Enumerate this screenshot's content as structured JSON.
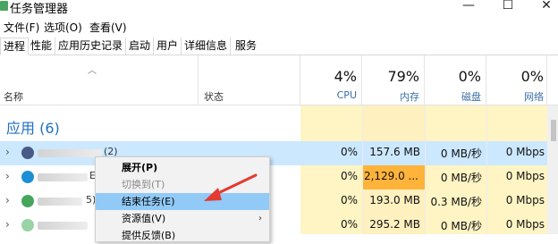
{
  "window": {
    "title": "任务管理器",
    "min": "—",
    "max": "☐",
    "close": "✕"
  },
  "menu": [
    "文件(F)",
    "选项(O)",
    "查看(V)"
  ],
  "tabs": [
    "进程",
    "性能",
    "应用历史记录",
    "启动",
    "用户",
    "详细信息",
    "服务"
  ],
  "columns": {
    "name": "名称",
    "status": "状态",
    "cpu": {
      "pct": "4%",
      "label": "CPU"
    },
    "mem": {
      "pct": "79%",
      "label": "内存"
    },
    "disk": {
      "pct": "0%",
      "label": "磁盘"
    },
    "net": {
      "pct": "0%",
      "label": "网络"
    }
  },
  "group_label": "应用 (6)",
  "rows": [
    {
      "suffix": "(2)",
      "cpu": "0%",
      "mem": "157.6 MB",
      "disk": "0 MB/秒",
      "net": "0 Mbps",
      "icon_color": "#4a5a86"
    },
    {
      "suffix": "E",
      "cpu": "0%",
      "mem": "2,129.0 ...",
      "disk": "0 MB/秒",
      "net": "0 Mbps",
      "icon_color": "#1e8fd6"
    },
    {
      "suffix": "5)",
      "cpu": "0%",
      "mem": "193.0 MB",
      "disk": "0.3 MB/秒",
      "net": "0 Mbps",
      "icon_color": "#46a65e"
    },
    {
      "suffix": "",
      "cpu": "0%",
      "mem": "295.2 MB",
      "disk": "0 MB/秒",
      "net": "0 Mbps",
      "icon_color": "#9ad3a6"
    }
  ],
  "context_menu": [
    "展开(P)",
    "切换到(T)",
    "结束任务(E)",
    "资源值(V)",
    "提供反馈(B)"
  ],
  "colors": {
    "accent": "#1f6fbf",
    "selected_row": "#cce8ff",
    "mem_high": "#ffb33a",
    "column_tint": "#fff4c4",
    "arrow": "#e53a2f"
  }
}
